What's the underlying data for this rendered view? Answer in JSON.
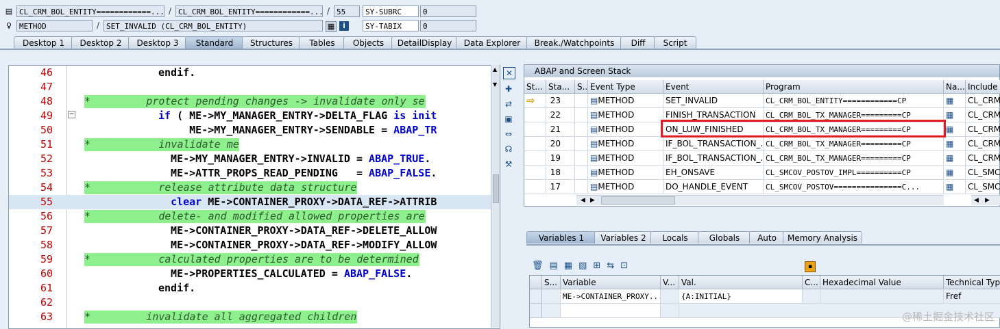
{
  "header": {
    "row1": {
      "class_field": "CL_CRM_BOL_ENTITY============...",
      "program_field": "CL_CRM_BOL_ENTITY============...",
      "line_value": "55",
      "sys_var_name": "SY-SUBRC",
      "sys_var_value": "0",
      "separator": "/"
    },
    "row2": {
      "type_field": "METHOD",
      "method_field": "SET_INVALID (CL_CRM_BOL_ENTITY)",
      "sys_var_name": "SY-TABIX",
      "sys_var_value": "0",
      "separator": "/"
    }
  },
  "main_tabs": [
    {
      "label": "Desktop 1",
      "active": false
    },
    {
      "label": "Desktop 2",
      "active": false
    },
    {
      "label": "Desktop 3",
      "active": false
    },
    {
      "label": "Standard",
      "active": true
    },
    {
      "label": "Structures",
      "active": false
    },
    {
      "label": "Tables",
      "active": false
    },
    {
      "label": "Objects",
      "active": false
    },
    {
      "label": "DetailDisplay",
      "active": false
    },
    {
      "label": "Data Explorer",
      "active": false
    },
    {
      "label": "Break./Watchpoints",
      "active": false
    },
    {
      "label": "Diff",
      "active": false
    },
    {
      "label": "Script",
      "active": false
    }
  ],
  "code_lines": [
    {
      "num": "46",
      "text": "endif.",
      "indent": 110,
      "comment": false,
      "current": false
    },
    {
      "num": "47",
      "text": "",
      "indent": 110,
      "comment": false,
      "current": false
    },
    {
      "num": "48",
      "text": "*         protect pending changes -> invalidate only se",
      "indent": 0,
      "comment": true,
      "current": false
    },
    {
      "num": "49",
      "text": "if ( ME->MY_MANAGER_ENTRY->DELTA_FLAG is init",
      "indent": 110,
      "comment": false,
      "current": false
    },
    {
      "num": "50",
      "text": "     ME->MY_MANAGER_ENTRY->SENDABLE = ABAP_TR",
      "indent": 110,
      "comment": false,
      "current": false
    },
    {
      "num": "51",
      "text": "*           invalidate me",
      "indent": 0,
      "comment": true,
      "current": false
    },
    {
      "num": "52",
      "text": "  ME->MY_MANAGER_ENTRY->INVALID = ABAP_TRUE.",
      "indent": 110,
      "comment": false,
      "current": false
    },
    {
      "num": "53",
      "text": "  ME->ATTR_PROPS_READ_PENDING   = ABAP_FALSE.",
      "indent": 110,
      "comment": false,
      "current": false
    },
    {
      "num": "54",
      "text": "*           release attribute data structure",
      "indent": 0,
      "comment": true,
      "current": false
    },
    {
      "num": "55",
      "text": "  clear ME->CONTAINER_PROXY->DATA_REF->ATTRIB",
      "indent": 110,
      "comment": false,
      "current": true
    },
    {
      "num": "56",
      "text": "*           delete- and modified allowed properties are",
      "indent": 0,
      "comment": true,
      "current": false
    },
    {
      "num": "57",
      "text": "  ME->CONTAINER_PROXY->DATA_REF->DELETE_ALLOW",
      "indent": 110,
      "comment": false,
      "current": false
    },
    {
      "num": "58",
      "text": "  ME->CONTAINER_PROXY->DATA_REF->MODIFY_ALLOW",
      "indent": 110,
      "comment": false,
      "current": false
    },
    {
      "num": "59",
      "text": "*           calculated properties are to be determined",
      "indent": 0,
      "comment": true,
      "current": false
    },
    {
      "num": "60",
      "text": "  ME->PROPERTIES_CALCULATED = ABAP_FALSE.",
      "indent": 110,
      "comment": false,
      "current": false
    },
    {
      "num": "61",
      "text": "endif.",
      "indent": 110,
      "comment": false,
      "current": false
    },
    {
      "num": "62",
      "text": "",
      "indent": 110,
      "comment": false,
      "current": false
    },
    {
      "num": "63",
      "text": "*         invalidate all aggregated children",
      "indent": 0,
      "comment": true,
      "current": false
    }
  ],
  "stack": {
    "title": "ABAP and Screen Stack",
    "columns": [
      "St...",
      "Sta...",
      "S...",
      "Event Type",
      "Event",
      "Program",
      "Na...",
      "Include"
    ],
    "rows": [
      {
        "level": "23",
        "event_type": "METHOD",
        "event": "SET_INVALID",
        "program": "CL_CRM_BOL_ENTITY============CP",
        "include": "CL_CRM_...",
        "current": true
      },
      {
        "level": "22",
        "event_type": "METHOD",
        "event": "FINISH_TRANSACTION",
        "program": "CL_CRM_BOL_TX_MANAGER=========CP",
        "include": "CL_CRM_...",
        "current": false
      },
      {
        "level": "21",
        "event_type": "METHOD",
        "event": "ON_LUW_FINISHED",
        "program": "CL_CRM_BOL_TX_MANAGER=========CP",
        "include": "CL_CRM_...",
        "current": false
      },
      {
        "level": "20",
        "event_type": "METHOD",
        "event": "IF_BOL_TRANSACTION_...",
        "program": "CL_CRM_BOL_TX_MANAGER=========CP",
        "include": "CL_CRM_...",
        "current": false
      },
      {
        "level": "19",
        "event_type": "METHOD",
        "event": "IF_BOL_TRANSACTION_...",
        "program": "CL_CRM_BOL_TX_MANAGER=========CP",
        "include": "CL_CRM_...",
        "current": false
      },
      {
        "level": "18",
        "event_type": "METHOD",
        "event": "EH_ONSAVE",
        "program": "CL_SMCOV_POSTOV_IMPL==========CP",
        "include": "CL_SMCO...",
        "current": false
      },
      {
        "level": "17",
        "event_type": "METHOD",
        "event": "DO_HANDLE_EVENT",
        "program": "CL_SMCOV_POSTOV===============C...",
        "include": "CL_SMCO...",
        "current": false
      }
    ]
  },
  "var_tabs": [
    {
      "label": "Variables 1",
      "active": true
    },
    {
      "label": "Variables 2",
      "active": false
    },
    {
      "label": "Locals",
      "active": false
    },
    {
      "label": "Globals",
      "active": false
    },
    {
      "label": "Auto",
      "active": false
    },
    {
      "label": "Memory Analysis",
      "active": false
    }
  ],
  "variables": {
    "columns": [
      "S...",
      "Variable",
      "V...",
      "Val.",
      "C...",
      "Hexadecimal Value",
      "Technical Typ"
    ],
    "rows": [
      {
        "variable": "ME->CONTAINER_PROXY...",
        "value": "{A:INITIAL}",
        "hex": "",
        "tech_type": "Fref"
      }
    ]
  },
  "watermark": "@稀土掘金技术社区",
  "colors": {
    "comment_bg": "#8df08d",
    "keyword": "#0000cc",
    "line_number": "#c00000",
    "highlight": "#e31b23"
  }
}
